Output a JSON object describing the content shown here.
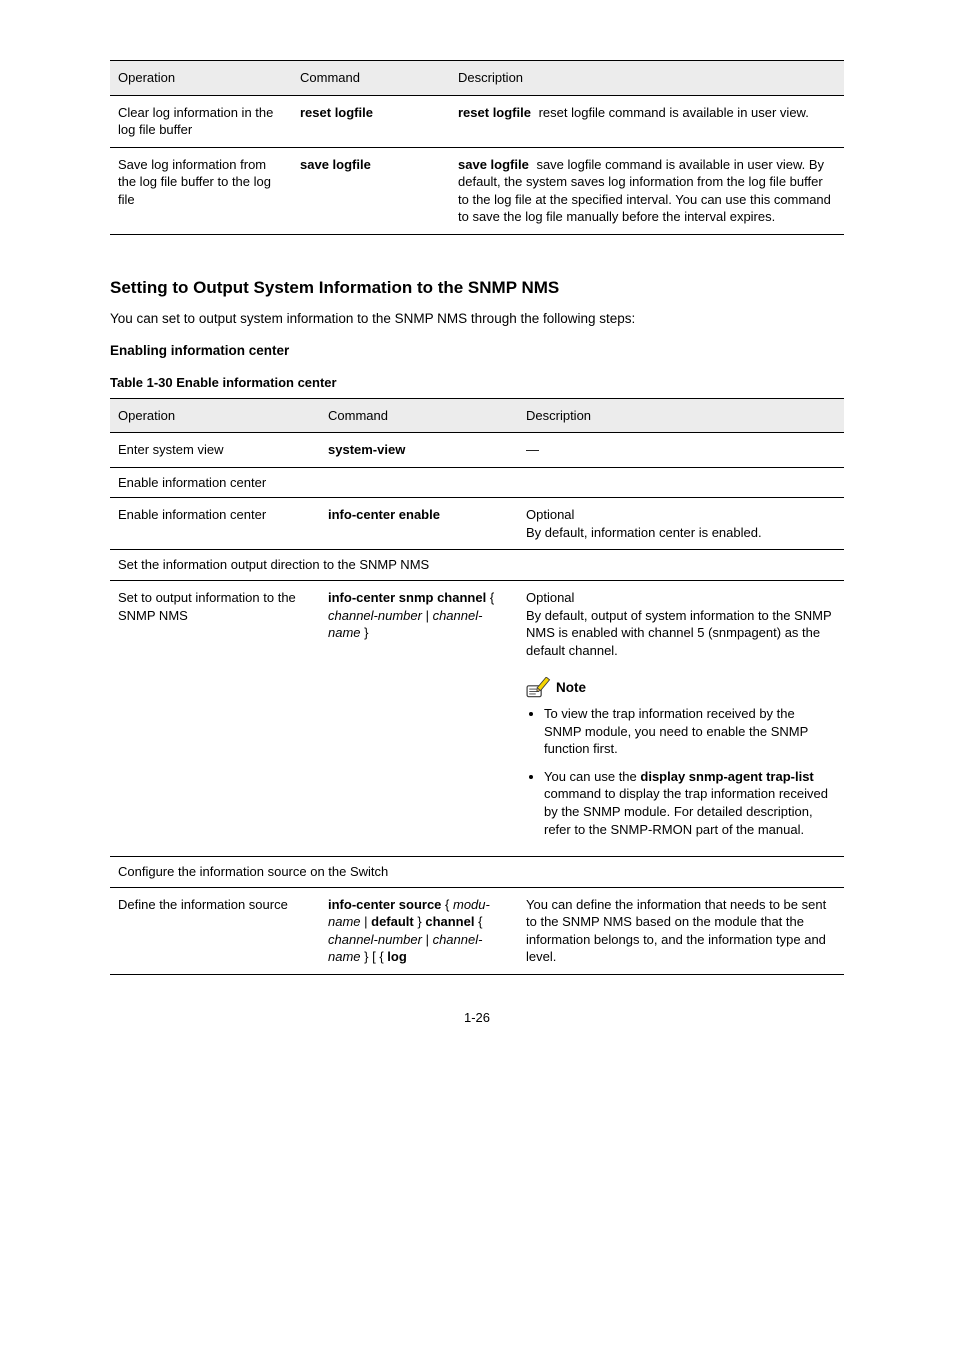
{
  "table1": {
    "headers": [
      "Operation",
      "Command",
      "Description"
    ],
    "rows": [
      {
        "operation": "Clear log information in the log file buffer",
        "command": {
          "bold": "reset logfile"
        },
        "description": "reset logfile command is available in user view."
      },
      {
        "operation": "Save log information from the log file buffer to the log file",
        "command": {
          "bold": "save logfile"
        },
        "description": "save logfile command is available in user view. By default, the system saves log information from the log file buffer to the log file at the specified interval. You can use this command to save the log file manually before the interval expires."
      }
    ]
  },
  "section": {
    "heading": "Setting to Output System Information to the SNMP NMS",
    "para1": "You can set to output system information to the SNMP NMS through the following steps:",
    "sub1": "Enabling information center",
    "caption1": "Table 1-30 Enable information center"
  },
  "table2": {
    "headers": [
      "Operation",
      "Command",
      "Description"
    ],
    "rows_r1": {
      "operation": "Enter system view",
      "command": {
        "bold": "system-view"
      },
      "description": "—"
    },
    "sectA_label": "Enable information center",
    "rows_r2": {
      "operation": "Enable information center",
      "command": {
        "bold": "info-center enable"
      },
      "description": "Optional\nBy default, information center is enabled."
    },
    "sectB_label": "Set the information output direction to the SNMP NMS",
    "rows_r3": {
      "operation": "Set to output information to the SNMP NMS",
      "command": {
        "segments": [
          {
            "bold": true,
            "text": "info-center snmp channel "
          },
          {
            "bold": false,
            "text": "{ "
          },
          {
            "italic": true,
            "text": "channel-number"
          },
          {
            "bold": false,
            "text": " | "
          },
          {
            "italic": true,
            "text": "channel-name"
          },
          {
            "bold": false,
            "text": " }"
          }
        ]
      },
      "note_label": "Note",
      "note_lead": "Optional\nBy default, output of system information to the SNMP NMS is enabled with channel 5 (snmpagent) as the default channel.",
      "note_bullets": [
        "To view the trap information received by the SNMP module, you need to enable the SNMP function first.",
        "You can use the display snmp-agent trap-list command to display the trap information received by the SNMP module. For detailed description, refer to the SNMP-RMON part of the manual."
      ]
    },
    "sectC_label": "Configure the information source on the Switch",
    "rows_r4": {
      "operation": "Define the information source",
      "command": {
        "segments": [
          {
            "bold": true,
            "text": "info-center source "
          },
          {
            "bold": false,
            "text": "{ "
          },
          {
            "italic": true,
            "text": "modu-name"
          },
          {
            "bold": false,
            "text": " | "
          },
          {
            "bold": true,
            "text": "default "
          },
          {
            "bold": false,
            "text": "} "
          },
          {
            "bold": true,
            "text": "channel "
          },
          {
            "bold": false,
            "text": "{ "
          },
          {
            "italic": true,
            "text": "channel-number"
          },
          {
            "bold": false,
            "text": " | "
          },
          {
            "italic": true,
            "text": "channel-name"
          },
          {
            "bold": false,
            "text": " } [ { "
          },
          {
            "bold": true,
            "text": "log"
          }
        ]
      },
      "description": "You can define the information that needs to be sent to the SNMP NMS based on the module that the information belongs to, and the information type and level."
    }
  },
  "note_icon_name": "note-pencil-icon",
  "page_number": "1-26"
}
